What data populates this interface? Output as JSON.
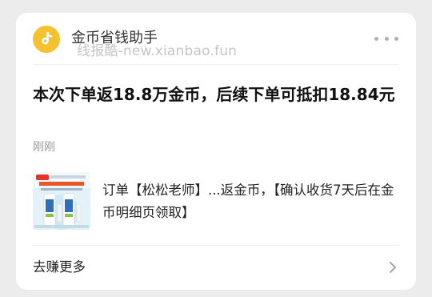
{
  "app": {
    "name": "金币省钱助手",
    "icon": "tiktok-note-icon",
    "icon_color": "#f5c12e"
  },
  "watermark": "线报酷-new.xianbao.fun",
  "message": {
    "title": "本次下单返18.8万金币，后续下单可抵扣18.84元",
    "time": "刚刚",
    "description": "订单【松松老师】...返金币，【确认收货7天后在金币明细页领取】",
    "thumbnail": "toothpaste-product-image"
  },
  "footer": {
    "label": "去赚更多",
    "icon": "chevron-right-icon"
  }
}
